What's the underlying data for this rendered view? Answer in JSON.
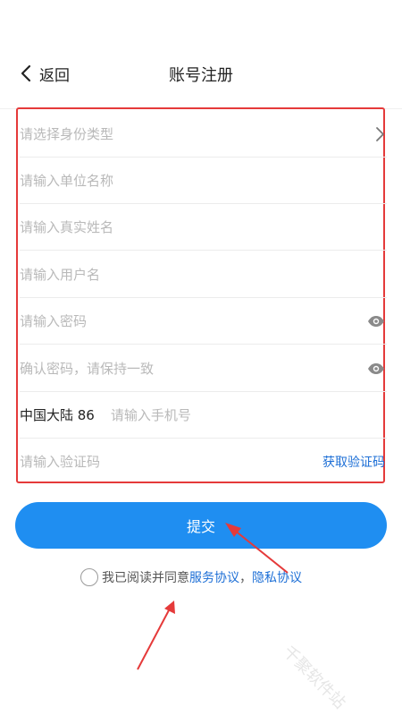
{
  "header": {
    "back_label": "返回",
    "title": "账号注册"
  },
  "form": {
    "identity_type_placeholder": "请选择身份类型",
    "organization_placeholder": "请输入单位名称",
    "real_name_placeholder": "请输入真实姓名",
    "username_placeholder": "请输入用户名",
    "password_placeholder": "请输入密码",
    "confirm_password_placeholder": "确认密码，请保持一致",
    "region_label": "中国大陆 86",
    "phone_placeholder": "请输入手机号",
    "code_placeholder": "请输入验证码",
    "get_code_label": "获取验证码"
  },
  "submit_label": "提交",
  "agreement": {
    "text": "我已阅读并同意",
    "service_link": "服务协议",
    "separator": "，",
    "privacy_link": "隐私协议"
  },
  "watermark": "千聚软件站",
  "colors": {
    "primary": "#1f8ef1",
    "link": "#1d6fd6",
    "annotation": "#e53a3a"
  },
  "icons": {
    "back": "chevron-left-icon",
    "select": "chevron-right-icon",
    "password_visibility": "eye-icon"
  }
}
